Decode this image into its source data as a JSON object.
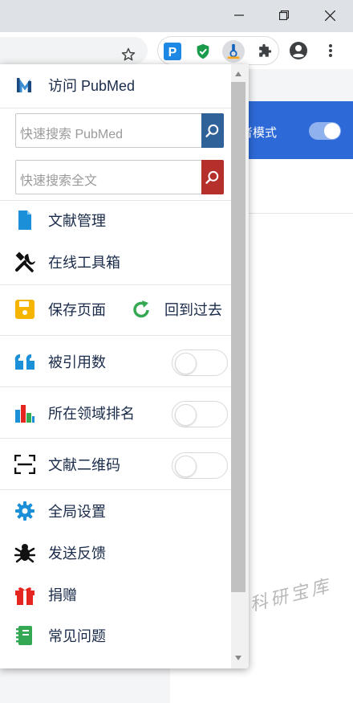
{
  "browser": {
    "extensions": [
      "p-extension-icon",
      "shield-extension-icon",
      "scholar-extension-icon"
    ],
    "accent": "#1a73e8"
  },
  "page": {
    "banner_text": "者模式",
    "watermark": "艾米的科研宝库"
  },
  "popup": {
    "visit_pubmed": "访问 PubMed",
    "search_pubmed_placeholder": "快速搜索 PubMed",
    "search_fulltext_placeholder": "快速搜索全文",
    "doc_manage": "文献管理",
    "online_tools": "在线工具箱",
    "save_page": "保存页面",
    "go_back": "回到过去",
    "citations": "被引用数",
    "field_rank": "所在领域排名",
    "qr_code": "文献二维码",
    "global_settings": "全局设置",
    "send_feedback": "发送反馈",
    "donate": "捐赠",
    "faq": "常见问题",
    "toggles": {
      "citations": false,
      "field_rank": false,
      "qr_code": false
    },
    "colors": {
      "pubmed_search": "#2f6299",
      "fulltext_search": "#b6302b",
      "doc_icon": "#1b8fd8",
      "save_icon": "#f4b400",
      "refresh_icon": "#34a853",
      "quote_icon": "#1b8fd8",
      "gear_icon": "#1b8fd8",
      "gift_icon": "#e52620",
      "faq_icon": "#34a853"
    }
  }
}
